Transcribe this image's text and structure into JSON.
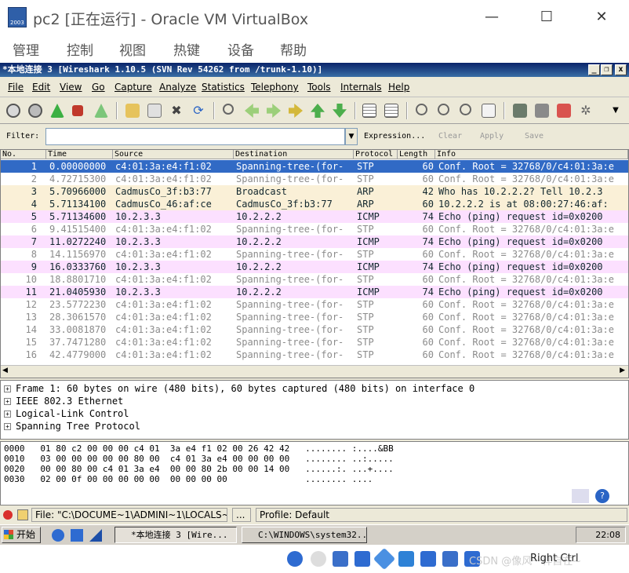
{
  "vbox": {
    "title": "pc2 [正在运行] - Oracle VM VirtualBox",
    "icon_text": "2003",
    "controls": {
      "minimize": "—",
      "maximize": "☐",
      "close": "✕"
    },
    "menu": [
      "管理",
      "控制",
      "视图",
      "热键",
      "设备",
      "帮助"
    ],
    "host_key": "Right Ctrl",
    "watermark": "CSDN @像风一样自在~"
  },
  "wireshark": {
    "title": "*本地连接 3   [Wireshark 1.10.5  (SVN Rev 54262 from /trunk-1.10)]",
    "title_controls": {
      "min": "_",
      "max": "❐",
      "close": "x"
    },
    "menu": [
      "File",
      "Edit",
      "View",
      "Go",
      "Capture",
      "Analyze",
      "Statistics",
      "Telephony",
      "Tools",
      "Internals",
      "Help"
    ],
    "filter": {
      "label": "Filter:",
      "value": "",
      "expression": "Expression...",
      "clear": "Clear",
      "apply": "Apply",
      "save": "Save"
    },
    "columns": [
      "No.",
      "Time",
      "Source",
      "Destination",
      "Protocol",
      "Length",
      "Info"
    ],
    "packets": [
      {
        "no": "1",
        "time": "0.00000000",
        "src": "c4:01:3a:e4:f1:02",
        "dst": "Spanning-tree-(for-",
        "proto": "STP",
        "len": "60",
        "info": "Conf. Root = 32768/0/c4:01:3a:e",
        "selected": true
      },
      {
        "no": "2",
        "time": "4.72715300",
        "src": "c4:01:3a:e4:f1:02",
        "dst": "Spanning-tree-(for-",
        "proto": "STP",
        "len": "60",
        "info": "Conf. Root = 32768/0/c4:01:3a:e",
        "bg": "#ffffff",
        "fg": "#8c8c8c"
      },
      {
        "no": "3",
        "time": "5.70966000",
        "src": "CadmusCo_3f:b3:77",
        "dst": "Broadcast",
        "proto": "ARP",
        "len": "42",
        "info": "Who has 10.2.2.2?  Tell 10.2.3",
        "bg": "#faf0d7",
        "fg": "#12272e"
      },
      {
        "no": "4",
        "time": "5.71134100",
        "src": "CadmusCo_46:af:ce",
        "dst": "CadmusCo_3f:b3:77",
        "proto": "ARP",
        "len": "60",
        "info": "10.2.2.2 is at 08:00:27:46:af:",
        "bg": "#faf0d7",
        "fg": "#12272e"
      },
      {
        "no": "5",
        "time": "5.71134600",
        "src": "10.2.3.3",
        "dst": "10.2.2.2",
        "proto": "ICMP",
        "len": "74",
        "info": "Echo (ping) request  id=0x0200",
        "bg": "#fce0ff",
        "fg": "#12272e"
      },
      {
        "no": "6",
        "time": "9.41515400",
        "src": "c4:01:3a:e4:f1:02",
        "dst": "Spanning-tree-(for-",
        "proto": "STP",
        "len": "60",
        "info": "Conf. Root = 32768/0/c4:01:3a:e",
        "bg": "#ffffff",
        "fg": "#8c8c8c"
      },
      {
        "no": "7",
        "time": "11.0272240",
        "src": "10.2.3.3",
        "dst": "10.2.2.2",
        "proto": "ICMP",
        "len": "74",
        "info": "Echo (ping) request  id=0x0200",
        "bg": "#fce0ff",
        "fg": "#12272e"
      },
      {
        "no": "8",
        "time": "14.1156970",
        "src": "c4:01:3a:e4:f1:02",
        "dst": "Spanning-tree-(for-",
        "proto": "STP",
        "len": "60",
        "info": "Conf. Root = 32768/0/c4:01:3a:e",
        "bg": "#ffffff",
        "fg": "#8c8c8c"
      },
      {
        "no": "9",
        "time": "16.0333760",
        "src": "10.2.3.3",
        "dst": "10.2.2.2",
        "proto": "ICMP",
        "len": "74",
        "info": "Echo (ping) request  id=0x0200",
        "bg": "#fce0ff",
        "fg": "#12272e"
      },
      {
        "no": "10",
        "time": "18.8801710",
        "src": "c4:01:3a:e4:f1:02",
        "dst": "Spanning-tree-(for-",
        "proto": "STP",
        "len": "60",
        "info": "Conf. Root = 32768/0/c4:01:3a:e",
        "bg": "#ffffff",
        "fg": "#8c8c8c"
      },
      {
        "no": "11",
        "time": "21.0405930",
        "src": "10.2.3.3",
        "dst": "10.2.2.2",
        "proto": "ICMP",
        "len": "74",
        "info": "Echo (ping) request  id=0x0200",
        "bg": "#fce0ff",
        "fg": "#12272e"
      },
      {
        "no": "12",
        "time": "23.5772230",
        "src": "c4:01:3a:e4:f1:02",
        "dst": "Spanning-tree-(for-",
        "proto": "STP",
        "len": "60",
        "info": "Conf. Root = 32768/0/c4:01:3a:e",
        "bg": "#ffffff",
        "fg": "#8c8c8c"
      },
      {
        "no": "13",
        "time": "28.3061570",
        "src": "c4:01:3a:e4:f1:02",
        "dst": "Spanning-tree-(for-",
        "proto": "STP",
        "len": "60",
        "info": "Conf. Root = 32768/0/c4:01:3a:e",
        "bg": "#ffffff",
        "fg": "#8c8c8c"
      },
      {
        "no": "14",
        "time": "33.0081870",
        "src": "c4:01:3a:e4:f1:02",
        "dst": "Spanning-tree-(for-",
        "proto": "STP",
        "len": "60",
        "info": "Conf. Root = 32768/0/c4:01:3a:e",
        "bg": "#ffffff",
        "fg": "#8c8c8c"
      },
      {
        "no": "15",
        "time": "37.7471280",
        "src": "c4:01:3a:e4:f1:02",
        "dst": "Spanning-tree-(for-",
        "proto": "STP",
        "len": "60",
        "info": "Conf. Root = 32768/0/c4:01:3a:e",
        "bg": "#ffffff",
        "fg": "#8c8c8c"
      },
      {
        "no": "16",
        "time": "42.4779000",
        "src": "c4:01:3a:e4:f1:02",
        "dst": "Spanning-tree-(for-",
        "proto": "STP",
        "len": "60",
        "info": "Conf. Root = 32768/0/c4:01:3a:e",
        "bg": "#ffffff",
        "fg": "#8c8c8c"
      }
    ],
    "details": [
      "Frame 1: 60 bytes on wire (480 bits), 60 bytes captured (480 bits) on interface 0",
      "IEEE 802.3 Ethernet",
      "Logical-Link Control",
      "Spanning Tree Protocol"
    ],
    "bytes": [
      "0000   01 80 c2 00 00 00 c4 01  3a e4 f1 02 00 26 42 42   ........ :....&BB",
      "0010   03 00 00 00 00 00 80 00  c4 01 3a e4 00 00 00 00   ........ ..:.....",
      "0020   00 00 80 00 c4 01 3a e4  00 00 80 2b 00 00 14 00   ......:. ...+....",
      "0030   02 00 0f 00 00 00 00 00  00 00 00 00               ........ ...."
    ],
    "status": {
      "file": "File: \"C:\\DOCUME~1\\ADMINI~1\\LOCALS~...",
      "packets": "...",
      "profile": "Profile: Default"
    }
  },
  "taskbar": {
    "start": "开始",
    "tasks": [
      "*本地连接 3  [Wire...",
      "C:\\WINDOWS\\system32..."
    ],
    "clock": "22:08"
  },
  "colors": {
    "selected_bg": "#316ac5",
    "stp_fg": "#8c8c8c",
    "arp_bg": "#faf0d7",
    "icmp_bg": "#fce0ff"
  }
}
